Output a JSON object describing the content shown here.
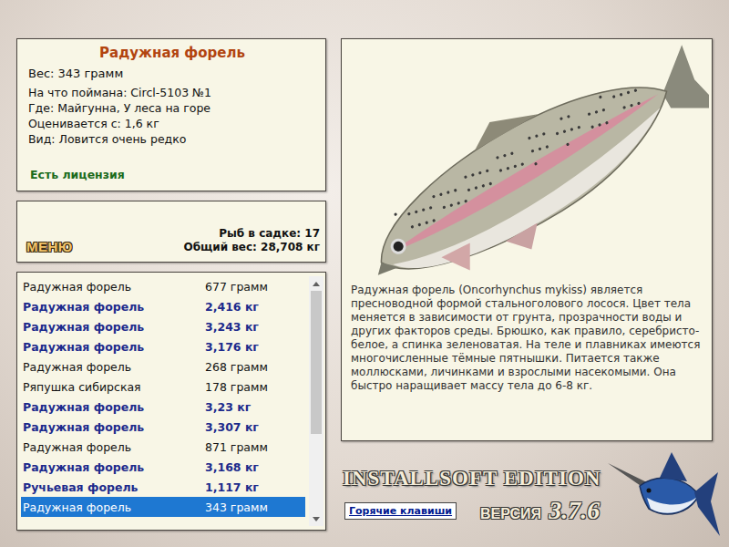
{
  "fish_card": {
    "name": "Радужная форель",
    "weight": "Вес: 343 грамм",
    "details": [
      "На что поймана: Circl-5103 №1",
      "Где: Майгунна, У леса на горе",
      "Оценивается с: 1,6 кг",
      "Вид: Ловится очень редко"
    ],
    "license": "Есть лицензия"
  },
  "menu_button": "МЕНЮ",
  "keepnet": {
    "count": "Рыб в садке: 17",
    "total": "Общий вес: 28,708 кг"
  },
  "catch_list": {
    "scroll_level": 0.65,
    "rows": [
      {
        "name": "Радужная форель",
        "weight": "677 грамм",
        "trophy": false,
        "selected": false
      },
      {
        "name": "Радужная форель",
        "weight": "2,416 кг",
        "trophy": true,
        "selected": false
      },
      {
        "name": "Радужная форель",
        "weight": "3,243 кг",
        "trophy": true,
        "selected": false
      },
      {
        "name": "Радужная форель",
        "weight": "3,176 кг",
        "trophy": true,
        "selected": false
      },
      {
        "name": "Радужная форель",
        "weight": "268 грамм",
        "trophy": false,
        "selected": false
      },
      {
        "name": "Ряпушка сибирская",
        "weight": "178 грамм",
        "trophy": false,
        "selected": false
      },
      {
        "name": "Радужная форель",
        "weight": "3,23 кг",
        "trophy": true,
        "selected": false
      },
      {
        "name": "Радужная форель",
        "weight": "3,307 кг",
        "trophy": true,
        "selected": false
      },
      {
        "name": "Радужная форель",
        "weight": "871 грамм",
        "trophy": false,
        "selected": false
      },
      {
        "name": "Радужная форель",
        "weight": "3,168 кг",
        "trophy": true,
        "selected": false
      },
      {
        "name": "Ручьевая форель",
        "weight": "1,117 кг",
        "trophy": true,
        "selected": false
      },
      {
        "name": "Радужная форель",
        "weight": "343 грамм",
        "trophy": false,
        "selected": true
      }
    ]
  },
  "description": "Радужная форель (Oncorhynchus mykiss) является пресноводной формой стальноголового лосося. Цвет тела меняется в зависимости от грунта, прозрачности воды и других факторов среды. Брюшко, как правило, серебристо-белое, а спинка зеленоватая. На теле и плавниках имеются многочисленные тёмные пятнышки. Питается также моллюсками, личинками и взрослыми насекомыми. Она быстро наращивает массу тела до 6-8 кг.",
  "logo": {
    "title": "INSTALLSOFT EDITION",
    "version_label": "ВЕРСИЯ",
    "version": "3.7.6"
  },
  "hotkeys_button": "Горячие клавиши"
}
